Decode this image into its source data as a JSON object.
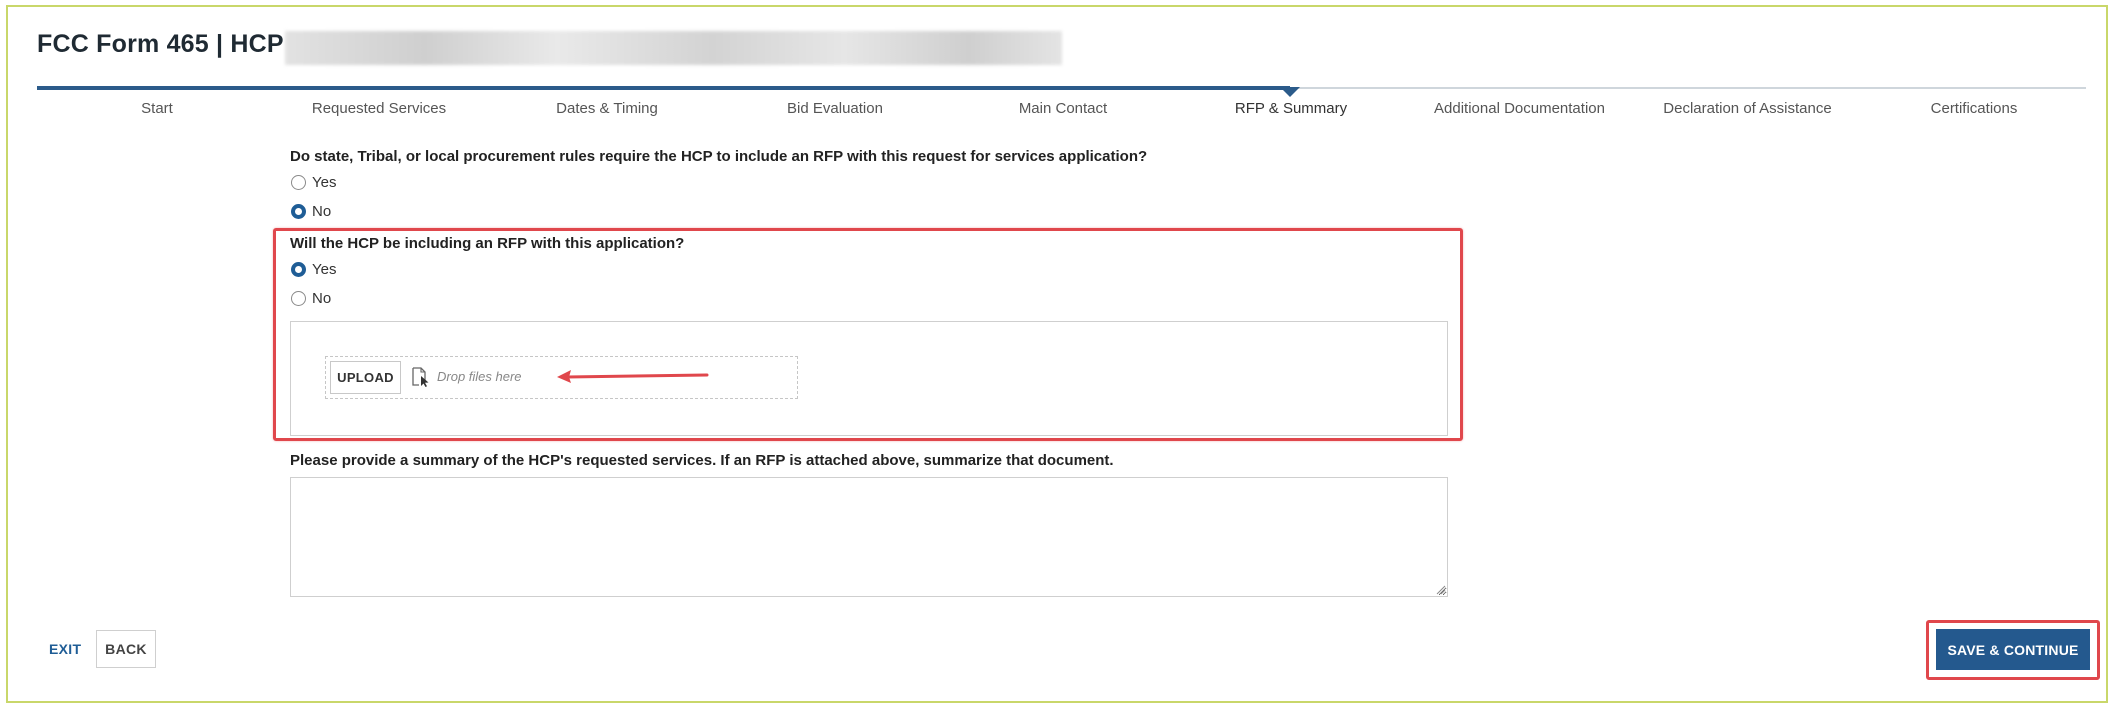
{
  "header": {
    "title": "FCC Form 465 | HCP"
  },
  "stepper": {
    "steps": [
      {
        "label": "Start"
      },
      {
        "label": "Requested Services"
      },
      {
        "label": "Dates & Timing"
      },
      {
        "label": "Bid Evaluation"
      },
      {
        "label": "Main Contact"
      },
      {
        "label": "RFP & Summary"
      },
      {
        "label": "Additional Documentation"
      },
      {
        "label": "Declaration of Assistance"
      },
      {
        "label": "Certifications"
      }
    ],
    "active_step": "RFP & Summary"
  },
  "question1": {
    "text": "Do state, Tribal, or local procurement rules require the HCP to include an RFP with this request for services application?",
    "options": [
      {
        "label": "Yes",
        "checked": false
      },
      {
        "label": "No",
        "checked": true
      }
    ]
  },
  "question2": {
    "text": "Will the HCP be including an RFP with this application?",
    "options": [
      {
        "label": "Yes",
        "checked": true
      },
      {
        "label": "No",
        "checked": false
      }
    ]
  },
  "upload": {
    "button_label": "UPLOAD",
    "drop_text": "Drop files here",
    "icon": "file-drop-icon"
  },
  "summary": {
    "label": "Please provide a summary of the HCP's requested services. If an RFP is attached above, summarize that document.",
    "value": ""
  },
  "footer": {
    "exit_label": "EXIT",
    "back_label": "BACK",
    "save_label": "SAVE & CONTINUE"
  },
  "colors": {
    "primary": "#24598e",
    "highlight": "#e0474c",
    "frame_border": "#c9d76a"
  }
}
